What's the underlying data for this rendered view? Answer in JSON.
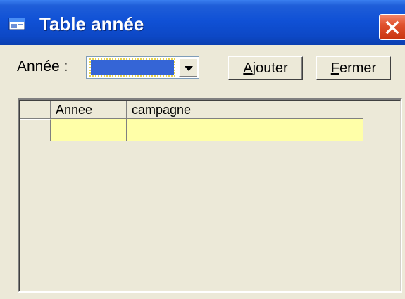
{
  "window": {
    "title": "Table année",
    "icon": "app-window-icon",
    "close_icon": "close-icon"
  },
  "toolbar": {
    "year_label": "Année :",
    "year_value": "",
    "add_label_accel": "A",
    "add_label_rest": "jouter",
    "close_label_accel": "F",
    "close_label_rest": "ermer"
  },
  "grid": {
    "columns": [
      "Annee",
      "campagne"
    ],
    "rows": [
      [
        "",
        ""
      ]
    ]
  },
  "colors": {
    "titlebar": "#0d48c6",
    "window_bg": "#ece9d8",
    "new_row": "#ffffa8",
    "combo_selected": "#3565d6",
    "close_button": "#e0512e"
  }
}
